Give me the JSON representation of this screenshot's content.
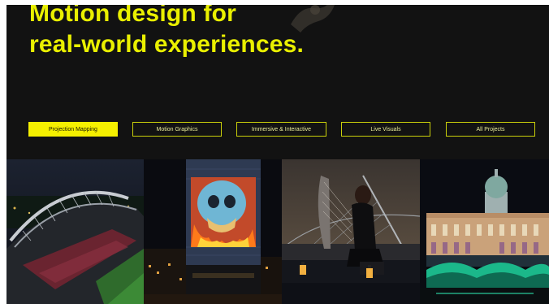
{
  "hero": {
    "headline_line1": "Motion design for",
    "headline_line2": "real-world experiences."
  },
  "filters": [
    {
      "label": "Projection Mapping",
      "active": true
    },
    {
      "label": "Motion Graphics",
      "active": false
    },
    {
      "label": "Immersive & Interactive",
      "active": false
    },
    {
      "label": "Live Visuals",
      "active": false
    },
    {
      "label": "All Projects",
      "active": false
    }
  ],
  "gallery": [
    {
      "subject": "stadium-aerial-night"
    },
    {
      "subject": "building-projection-skull"
    },
    {
      "subject": "harpist-bridge-night"
    },
    {
      "subject": "domed-building-illuminated"
    }
  ],
  "colors": {
    "background": "#121212",
    "accent": "#f5f000"
  }
}
